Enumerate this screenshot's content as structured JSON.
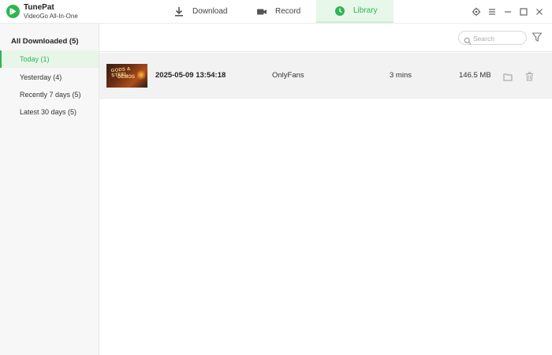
{
  "app": {
    "name": "TunePat",
    "subtitle": "VideoGo All-In-One",
    "accent_color": "#2fb552"
  },
  "tabs": [
    {
      "label": "Download",
      "icon": "download-icon",
      "active": false
    },
    {
      "label": "Record",
      "icon": "video-camera-icon",
      "active": false
    },
    {
      "label": "Library",
      "icon": "clock-icon",
      "active": true
    }
  ],
  "window_controls": [
    "settings-icon",
    "menu-icon",
    "minimize-icon",
    "maximize-icon",
    "close-icon"
  ],
  "sidebar": {
    "header": "All Downloaded (5)",
    "items": [
      {
        "label": "Today (1)",
        "active": true
      },
      {
        "label": "Yesterday (4)",
        "active": false
      },
      {
        "label": "Recently 7 days (5)",
        "active": false
      },
      {
        "label": "Latest 30 days (5)",
        "active": false
      }
    ]
  },
  "toolbar": {
    "search_placeholder": "Search",
    "filter_icon": "filter-icon"
  },
  "rows": [
    {
      "thumbnail_text_1": "GODS & STEEL",
      "thumbnail_text_2": "DEMOS",
      "datetime": "2025-05-09 13:54:18",
      "source": "OnlyFans",
      "duration": "3 mins",
      "size": "146.5 MB",
      "actions": [
        "folder-icon",
        "trash-icon"
      ]
    }
  ]
}
